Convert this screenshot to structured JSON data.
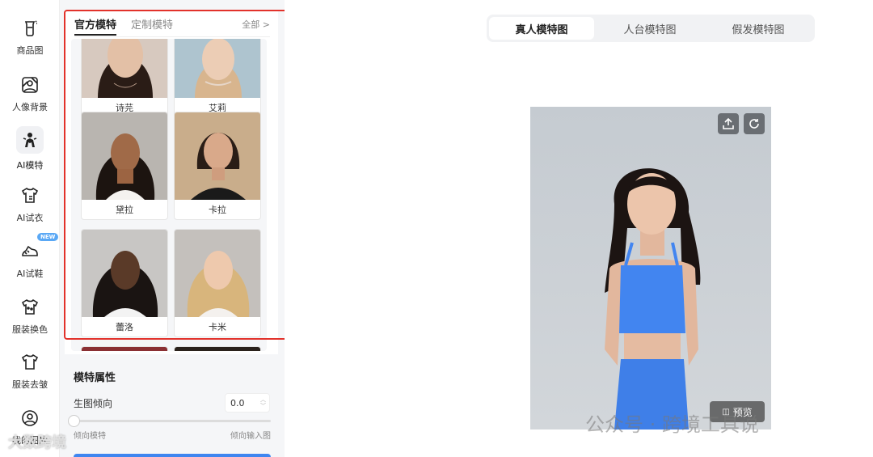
{
  "sidebar": {
    "items": [
      {
        "label": "商品图",
        "icon": "product-image-icon"
      },
      {
        "label": "人像背景",
        "icon": "portrait-background-icon"
      },
      {
        "label": "AI模特",
        "icon": "ai-model-icon",
        "active": true
      },
      {
        "label": "AI试衣",
        "icon": "ai-tryon-icon"
      },
      {
        "label": "AI试鞋",
        "icon": "ai-shoe-icon",
        "badge": "NEW"
      },
      {
        "label": "服装换色",
        "icon": "garment-recolor-icon"
      },
      {
        "label": "服装去皱",
        "icon": "garment-dewrinkle-icon"
      },
      {
        "label": "我的图片",
        "icon": "my-images-icon"
      }
    ]
  },
  "model_panel": {
    "tabs": [
      "官方模特",
      "定制模特"
    ],
    "all_link": "全部 >",
    "models": [
      {
        "name": "诗芫"
      },
      {
        "name": "艾莉"
      },
      {
        "name": "黛拉"
      },
      {
        "name": "卡拉"
      },
      {
        "name": "蕾洛"
      },
      {
        "name": "卡米"
      }
    ]
  },
  "model_attributes": {
    "title": "模特属性",
    "tendency_label": "生图倾向",
    "tendency_value": "0.0",
    "slider_left": "倾向模特",
    "slider_right": "倾向输入图",
    "slider_level": 0
  },
  "main": {
    "view_tabs": [
      "真人模特图",
      "人台模特图",
      "假发模特图"
    ],
    "active_view": "真人模特图",
    "preview_button": "预览",
    "upload_icon": "upload-icon",
    "refresh_icon": "refresh-icon"
  },
  "watermarks": {
    "right": "公众号 · 跨境工具说",
    "left": "大数跨境"
  },
  "colors": {
    "accent": "#3f86f0",
    "highlight_border": "#e2322b",
    "new_badge": "#5aa8f5"
  }
}
